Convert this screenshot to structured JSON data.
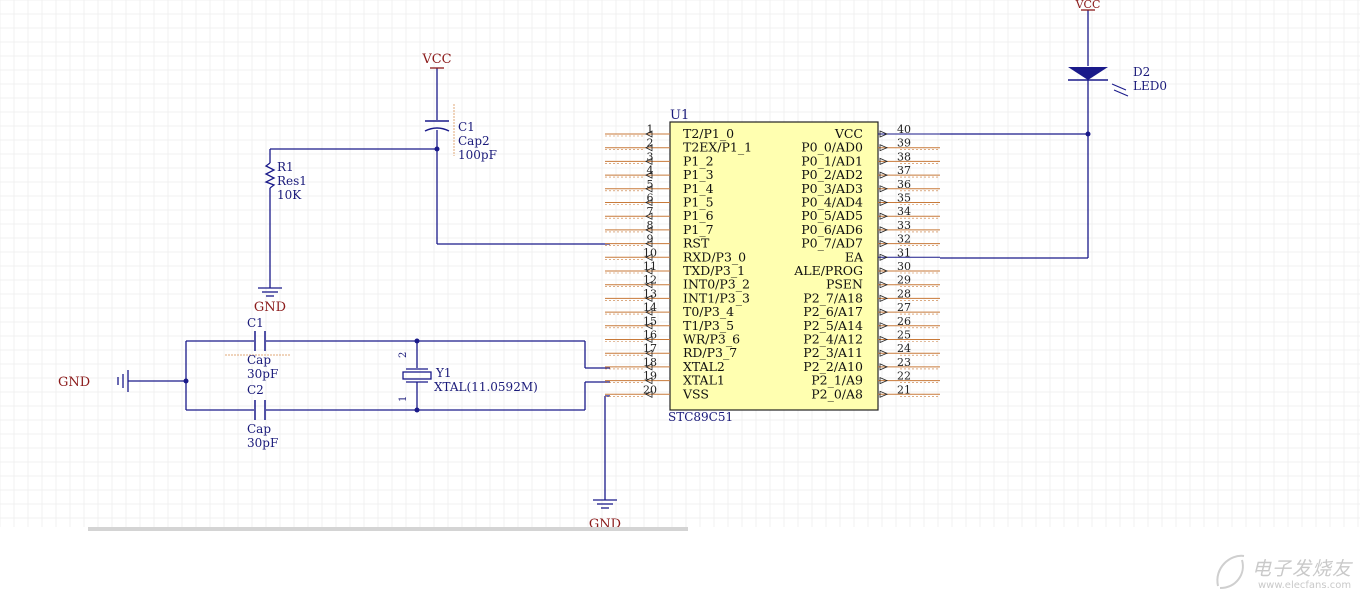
{
  "power": {
    "vcc": "VCC",
    "gnd": "GND"
  },
  "components": {
    "c1_top": {
      "ref": "C1",
      "type": "Cap2",
      "value": "100pF"
    },
    "r1": {
      "ref": "R1",
      "type": "Res1",
      "value": "10K"
    },
    "c1_osc": {
      "ref": "C1",
      "type": "Cap",
      "value": "30pF"
    },
    "c2_osc": {
      "ref": "C2",
      "type": "Cap",
      "value": "30pF"
    },
    "y1": {
      "ref": "Y1",
      "type": "XTAL(11.0592M)",
      "pin_a": "2",
      "pin_b": "1"
    },
    "d2": {
      "ref": "D2",
      "type": "LED0"
    }
  },
  "u1": {
    "ref": "U1",
    "part": "STC89C51",
    "left_pins": [
      {
        "num": "1",
        "name": "T2/P1_0"
      },
      {
        "num": "2",
        "name": "T2EX/P1_1"
      },
      {
        "num": "3",
        "name": "P1_2"
      },
      {
        "num": "4",
        "name": "P1_3"
      },
      {
        "num": "5",
        "name": "P1_4"
      },
      {
        "num": "6",
        "name": "P1_5"
      },
      {
        "num": "7",
        "name": "P1_6"
      },
      {
        "num": "8",
        "name": "P1_7"
      },
      {
        "num": "9",
        "name": "RST"
      },
      {
        "num": "10",
        "name": "RXD/P3_0"
      },
      {
        "num": "11",
        "name": "TXD/P3_1"
      },
      {
        "num": "12",
        "name": "INT0/P3_2"
      },
      {
        "num": "13",
        "name": "INT1/P3_3"
      },
      {
        "num": "14",
        "name": "T0/P3_4"
      },
      {
        "num": "15",
        "name": "T1/P3_5"
      },
      {
        "num": "16",
        "name": "WR/P3_6"
      },
      {
        "num": "17",
        "name": "RD/P3_7"
      },
      {
        "num": "18",
        "name": "XTAL2"
      },
      {
        "num": "19",
        "name": "XTAL1"
      },
      {
        "num": "20",
        "name": "VSS"
      }
    ],
    "right_pins": [
      {
        "num": "40",
        "name": "VCC"
      },
      {
        "num": "39",
        "name": "P0_0/AD0"
      },
      {
        "num": "38",
        "name": "P0_1/AD1"
      },
      {
        "num": "37",
        "name": "P0_2/AD2"
      },
      {
        "num": "36",
        "name": "P0_3/AD3"
      },
      {
        "num": "35",
        "name": "P0_4/AD4"
      },
      {
        "num": "34",
        "name": "P0_5/AD5"
      },
      {
        "num": "33",
        "name": "P0_6/AD6"
      },
      {
        "num": "32",
        "name": "P0_7/AD7"
      },
      {
        "num": "31",
        "name": "EA"
      },
      {
        "num": "30",
        "name": "ALE/PROG"
      },
      {
        "num": "29",
        "name": "PSEN"
      },
      {
        "num": "28",
        "name": "P2_7/A18"
      },
      {
        "num": "27",
        "name": "P2_6/A17"
      },
      {
        "num": "26",
        "name": "P2_5/A14"
      },
      {
        "num": "25",
        "name": "P2_4/A12"
      },
      {
        "num": "24",
        "name": "P2_3/A11"
      },
      {
        "num": "23",
        "name": "P2_2/A10"
      },
      {
        "num": "22",
        "name": "P2_1/A9"
      },
      {
        "num": "21",
        "name": "P2_0/A8"
      }
    ]
  },
  "watermark": {
    "cn": "电子发烧友",
    "en": "www.elecfans.com"
  },
  "colors": {
    "wire": "#1a1a8a",
    "power_label": "#8b1a1a",
    "chip_fill": "#ffffb0",
    "pin_stub": "#c87a3a",
    "grid": "#ececec"
  }
}
